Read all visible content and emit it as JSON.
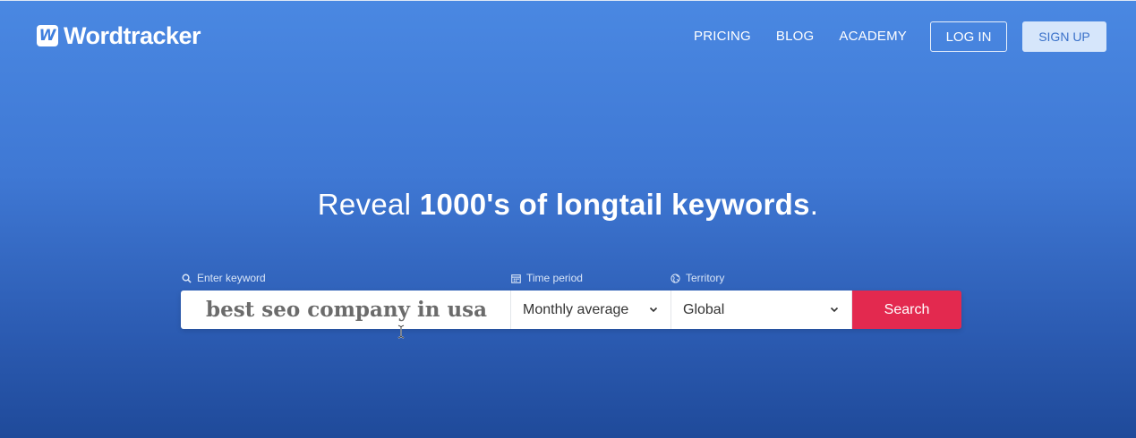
{
  "header": {
    "logo_mark": "W",
    "logo_text": "Wordtracker",
    "nav": {
      "pricing": "PRICING",
      "blog": "BLOG",
      "academy": "ACADEMY"
    },
    "login_label": "LOG IN",
    "signup_label": "SIGN UP"
  },
  "hero": {
    "title_light": "Reveal ",
    "title_bold": "1000's of longtail keywords",
    "title_end": "."
  },
  "search": {
    "keyword_label": "Enter keyword",
    "keyword_value": "best seo company in usa",
    "time_label": "Time period",
    "time_value": "Monthly average",
    "territory_label": "Territory",
    "territory_value": "Global",
    "button_label": "Search"
  },
  "colors": {
    "accent_red": "#e3294f",
    "brand_blue": "#4a88e2"
  },
  "icons": [
    "search-icon",
    "calendar-icon",
    "globe-icon",
    "chevron-down-icon",
    "text-cursor-icon"
  ]
}
